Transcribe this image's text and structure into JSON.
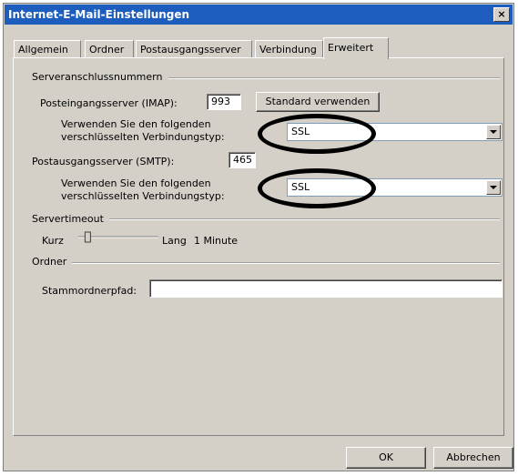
{
  "window": {
    "title": "Internet-E-Mail-Einstellungen",
    "close_label": "×"
  },
  "tabs": [
    {
      "label": "Allgemein",
      "active": false
    },
    {
      "label": "Ordner",
      "active": false
    },
    {
      "label": "Postausgangsserver",
      "active": false
    },
    {
      "label": "Verbindung",
      "active": false
    },
    {
      "label": "Erweitert",
      "active": true
    }
  ],
  "server_ports": {
    "group_label": "Serveranschlussnummern",
    "imap_label": "Posteingangsserver (IMAP):",
    "imap_value": "993",
    "default_button": "Standard verwenden",
    "enc_label_line1": "Verwenden Sie den folgenden",
    "enc_label_line2": "verschlüsselten Verbindungstyp:",
    "imap_encryption": "SSL",
    "smtp_label": "Postausgangsserver (SMTP):",
    "smtp_value": "465",
    "smtp_encryption": "SSL"
  },
  "timeout": {
    "group_label": "Servertimeout",
    "short_label": "Kurz",
    "long_label": "Lang",
    "value_label": "1 Minute",
    "level": 0.1
  },
  "folders": {
    "group_label": "Ordner",
    "root_label": "Stammordnerpfad:",
    "root_value": ""
  },
  "footer": {
    "ok_label": "OK",
    "cancel_label": "Abbrechen"
  }
}
